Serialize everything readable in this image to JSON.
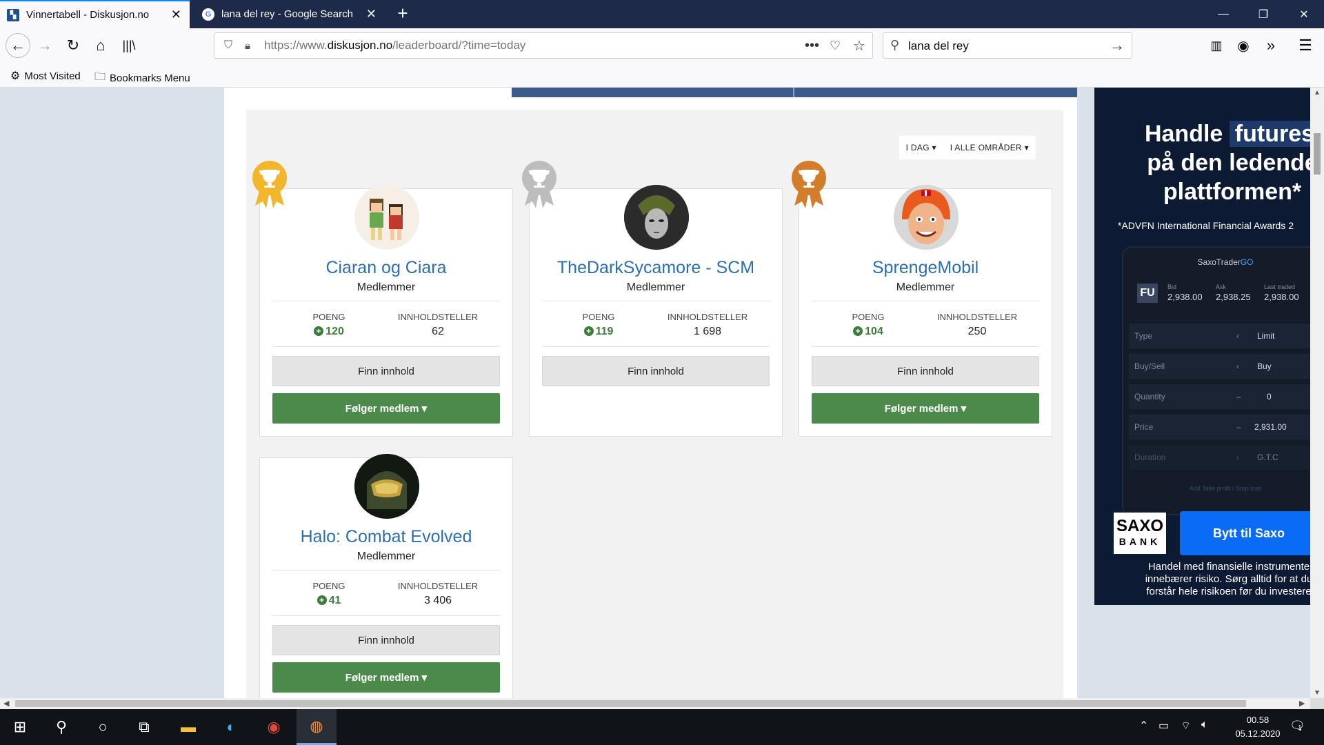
{
  "browser": {
    "tabs": [
      {
        "title": "Vinnertabell - Diskusjon.no",
        "active": true
      },
      {
        "title": "lana del rey - Google Search",
        "active": false
      }
    ],
    "url_prefix": "https://www.",
    "url_domain": "diskusjon.no",
    "url_path": "/leaderboard/?time=today",
    "search_value": "lana del rey",
    "bookmarks": [
      {
        "label": "Most Visited",
        "icon": "gear-icon"
      },
      {
        "label": "Bookmarks Menu",
        "icon": "folder-icon"
      }
    ]
  },
  "filters": {
    "time": "I DAG",
    "area": "I ALLE OMRÅDER"
  },
  "labels": {
    "points": "POENG",
    "content": "INNHOLDSTELLER",
    "find": "Finn innhold",
    "follow": "Følger medlem"
  },
  "leaders": [
    {
      "name": "Ciaran og Ciara",
      "role": "Medlemmer",
      "points": "120",
      "content": "62",
      "medal": "gold",
      "medal_color": "#f2b62d",
      "following": true
    },
    {
      "name": "TheDarkSycamore - SCM",
      "role": "Medlemmer",
      "points": "119",
      "content": "1 698",
      "medal": "silver",
      "medal_color": "#bdbdbd",
      "following": false
    },
    {
      "name": "SprengeMobil",
      "role": "Medlemmer",
      "points": "104",
      "content": "250",
      "medal": "bronze",
      "medal_color": "#d27d2c",
      "following": true
    },
    {
      "name": "Halo: Combat Evolved",
      "role": "Medlemmer",
      "points": "41",
      "content": "3 406",
      "medal": "none",
      "following": true
    }
  ],
  "ad": {
    "line1a": "Handle",
    "line1b": "futures",
    "line2": "på den ledende",
    "line3": "plattformen*",
    "award": "*ADVFN International Financial Awards 2",
    "app_title": "SaxoTrader",
    "app_title_go": "GO",
    "instrument": "FU",
    "bid_label": "Bid",
    "bid": "2,938.00",
    "ask_label": "Ask",
    "ask": "2,938.25",
    "last_label": "Last traded",
    "last": "2,938.00",
    "rows": [
      {
        "label": "Type",
        "value": "Limit"
      },
      {
        "label": "Buy/Sell",
        "value": "Buy"
      },
      {
        "label": "Quantity",
        "value": "0"
      },
      {
        "label": "Price",
        "value": "2,931.00"
      },
      {
        "label": "Duration",
        "value": "G.T.C"
      }
    ],
    "takeprofit": "Add Take profit / Stop loss",
    "logo_top": "SAXO",
    "logo_bottom": "BANK",
    "cta": "Bytt til Saxo",
    "disclaimer": [
      "Handel med finansielle instrumente",
      "innebærer risiko. Sørg alltid for at du",
      "forstår hele risikoen før du investere"
    ]
  },
  "taskbar": {
    "time": "00.58",
    "date": "05.12.2020",
    "notifications": "1"
  },
  "colors": {
    "link": "#2b6fb0",
    "follow": "#4b8a4b",
    "points": "#3c7d3c"
  }
}
